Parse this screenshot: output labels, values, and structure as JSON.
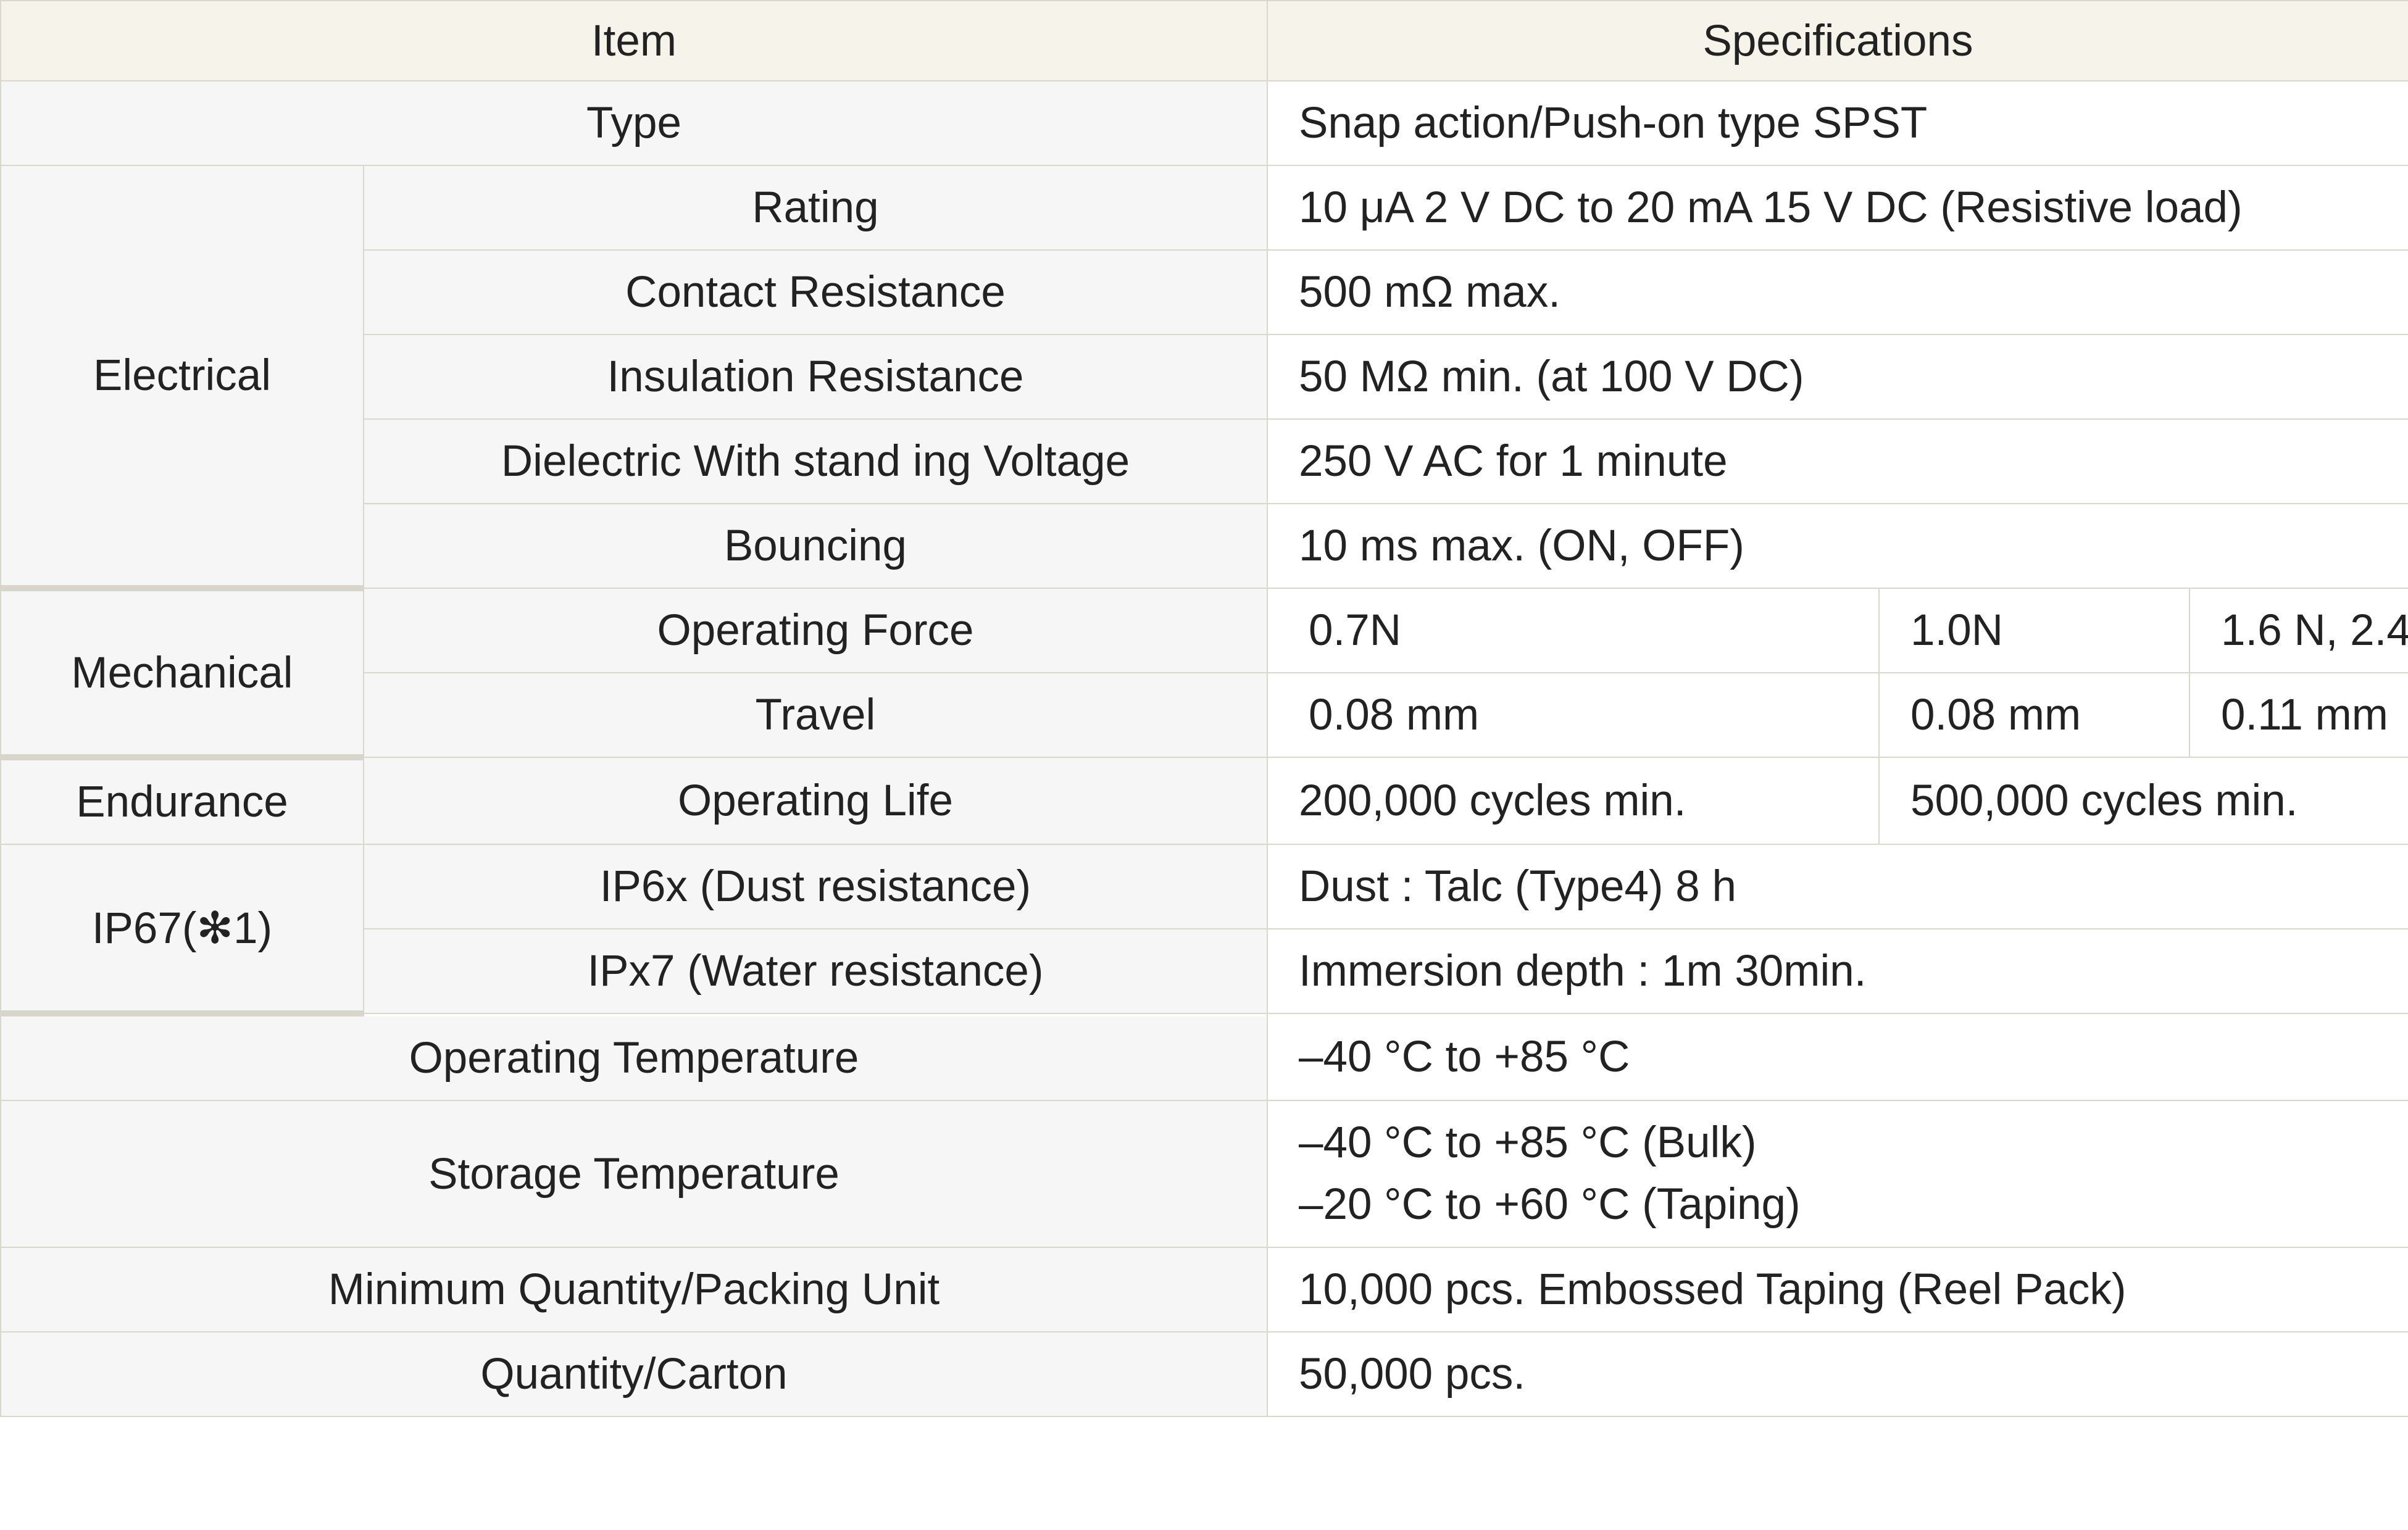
{
  "table": {
    "headers": {
      "item": "Item",
      "specifications": "Specifications"
    },
    "type": {
      "label": "Type",
      "value": "Snap action/Push-on type SPST"
    },
    "electrical": {
      "group": "Electrical",
      "rows": [
        {
          "label": "Rating",
          "value": "10 μA 2 V DC to 20 mA 15 V DC (Resistive load)"
        },
        {
          "label": "Contact Resistance",
          "value": "500 mΩ max."
        },
        {
          "label": "Insulation Resistance",
          "value": "50 MΩ min. (at 100 V DC)"
        },
        {
          "label": "Dielectric With stand ing Voltage",
          "value": "250 V AC for 1 minute"
        },
        {
          "label": "Bouncing",
          "value": "10 ms max. (ON, OFF)"
        }
      ]
    },
    "mechanical": {
      "group": "Mechanical",
      "operating_force": {
        "label": "Operating Force",
        "values": [
          "0.7N",
          "1.0N",
          "1.6 N, 2.4"
        ]
      },
      "travel": {
        "label": "Travel",
        "values": [
          "0.08 mm",
          "0.08 mm",
          "0.11 mm"
        ]
      }
    },
    "endurance": {
      "group": "Endurance",
      "label": "Operating Life",
      "values": [
        "200,000 cycles min.",
        "500,000 cycles min."
      ]
    },
    "ip67": {
      "group": "IP67(✻1)",
      "rows": [
        {
          "label": "IP6x (Dust resistance)",
          "value": "Dust : Talc (Type4) 8 h"
        },
        {
          "label": "IPx7 (Water resistance)",
          "value": "Immersion depth : 1m 30min."
        }
      ]
    },
    "operating_temperature": {
      "label": "Operating Temperature",
      "value": "–40 °C to +85 °C"
    },
    "storage_temperature": {
      "label": "Storage Temperature",
      "values": [
        "–40 °C to +85 °C (Bulk)",
        "–20 °C to +60 °C (Taping)"
      ]
    },
    "packing_unit": {
      "label": "Minimum Quantity/Packing Unit",
      "value": "10,000 pcs. Embossed Taping (Reel Pack)"
    },
    "carton": {
      "label": "Quantity/Carton",
      "value": "50,000 pcs."
    }
  }
}
